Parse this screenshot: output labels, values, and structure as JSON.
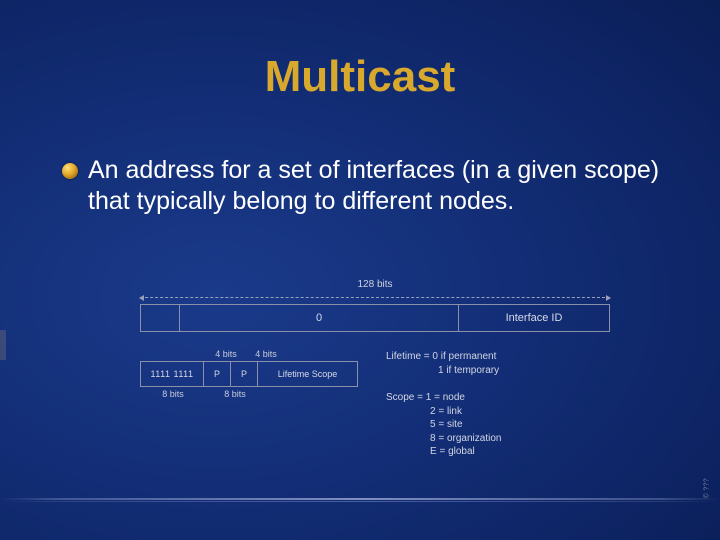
{
  "title": "Multicast",
  "bullet": "An address for a set of interfaces (in a given scope) that typically belong to different nodes.",
  "diagram": {
    "total_bits_label": "128 bits",
    "main_row": {
      "a": "",
      "b": "0",
      "c": "Interface ID"
    },
    "sub": {
      "top_labels": {
        "blank": "",
        "bits4a": "4 bits",
        "bits4b": "4 bits"
      },
      "cells": {
        "prefix": "1111 1111",
        "p1": "P",
        "p2": "P",
        "scope": "Lifetime Scope"
      },
      "bottom_labels": {
        "bits8": "8 bits",
        "bits8b": "8 bits"
      }
    },
    "legend": {
      "lifetime": {
        "label": "Lifetime =",
        "l0": "0 if permanent",
        "l1": "1 if temporary"
      },
      "scope": {
        "label": "Scope =",
        "s1": "1 = node",
        "s2": "2 = link",
        "s5": "5 = site",
        "s8": "8 = organization",
        "sE": "E = global"
      }
    }
  },
  "copyright": "© ???"
}
